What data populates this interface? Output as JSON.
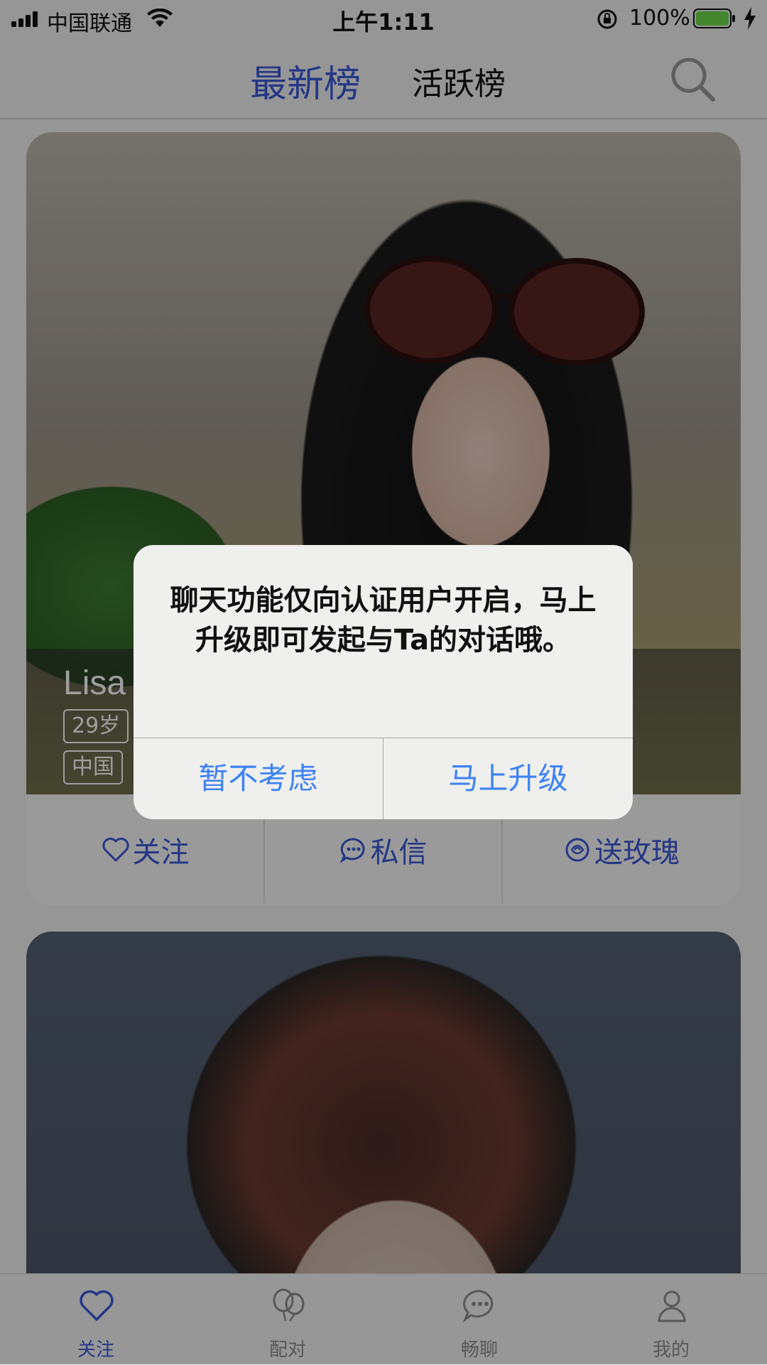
{
  "status_bar": {
    "carrier": "中国联通",
    "time": "上午1:11",
    "battery_pct": "100%"
  },
  "header": {
    "tabs": [
      {
        "label": "最新榜",
        "active": true
      },
      {
        "label": "活跃榜",
        "active": false
      }
    ],
    "search_icon": "search-icon"
  },
  "cards": [
    {
      "name": "Lisa",
      "age": "29岁",
      "country": "中国",
      "actions": [
        {
          "label": "关注",
          "icon": "heart-icon"
        },
        {
          "label": "私信",
          "icon": "chat-bubble-icon"
        },
        {
          "label": "送玫瑰",
          "icon": "rose-icon"
        }
      ]
    },
    {}
  ],
  "alert": {
    "message": "聊天功能仅向认证用户开启，马上升级即可发起与Ta的对话哦。",
    "cancel_label": "暂不考虑",
    "confirm_label": "马上升级"
  },
  "tabbar": {
    "items": [
      {
        "label": "关注",
        "icon": "heart-icon",
        "active": true
      },
      {
        "label": "配对",
        "icon": "balloons-icon",
        "active": false
      },
      {
        "label": "畅聊",
        "icon": "chat-bubble-icon",
        "active": false
      },
      {
        "label": "我的",
        "icon": "person-icon",
        "active": false
      }
    ]
  },
  "colors": {
    "accent": "#3a5ad9",
    "alert_button": "#3b82f6",
    "battery": "#6bd84a"
  }
}
